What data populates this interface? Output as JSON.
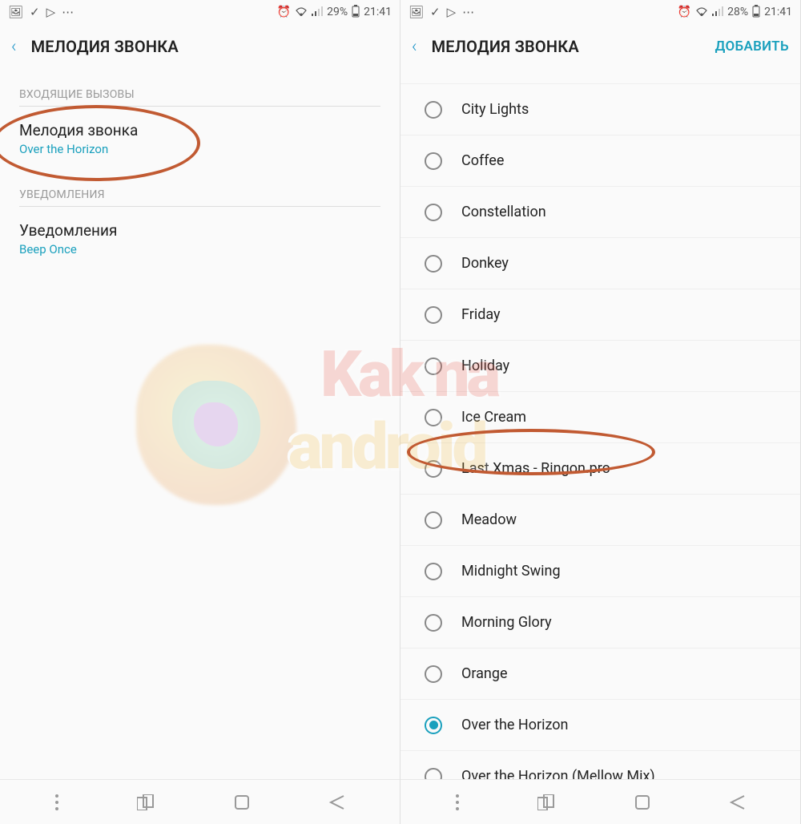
{
  "left": {
    "status": {
      "battery_pct": "29%",
      "time": "21:41"
    },
    "header": {
      "title": "МЕЛОДИЯ ЗВОНКА"
    },
    "section_incoming": "ВХОДЯЩИЕ ВЫЗОВЫ",
    "ringtone_setting": {
      "title": "Мелодия звонка",
      "value": "Over the Horizon"
    },
    "section_notif": "УВЕДОМЛЕНИЯ",
    "notif_setting": {
      "title": "Уведомления",
      "value": "Beep Once"
    }
  },
  "right": {
    "status": {
      "battery_pct": "28%",
      "time": "21:41"
    },
    "header": {
      "title": "МЕЛОДИЯ ЗВОНКА",
      "action": "ДОБАВИТЬ"
    },
    "ringtones": [
      {
        "label": "City Lights",
        "selected": false
      },
      {
        "label": "Coffee",
        "selected": false
      },
      {
        "label": "Constellation",
        "selected": false
      },
      {
        "label": "Donkey",
        "selected": false
      },
      {
        "label": "Friday",
        "selected": false
      },
      {
        "label": "Holiday",
        "selected": false
      },
      {
        "label": "Ice Cream",
        "selected": false
      },
      {
        "label": "Last Xmas - Ringon.pro",
        "selected": false
      },
      {
        "label": "Meadow",
        "selected": false
      },
      {
        "label": "Midnight Swing",
        "selected": false
      },
      {
        "label": "Morning Glory",
        "selected": false
      },
      {
        "label": "Orange",
        "selected": false
      },
      {
        "label": "Over the Horizon",
        "selected": true
      },
      {
        "label": "Over the Horizon (Mellow Mix)",
        "selected": false
      }
    ]
  }
}
